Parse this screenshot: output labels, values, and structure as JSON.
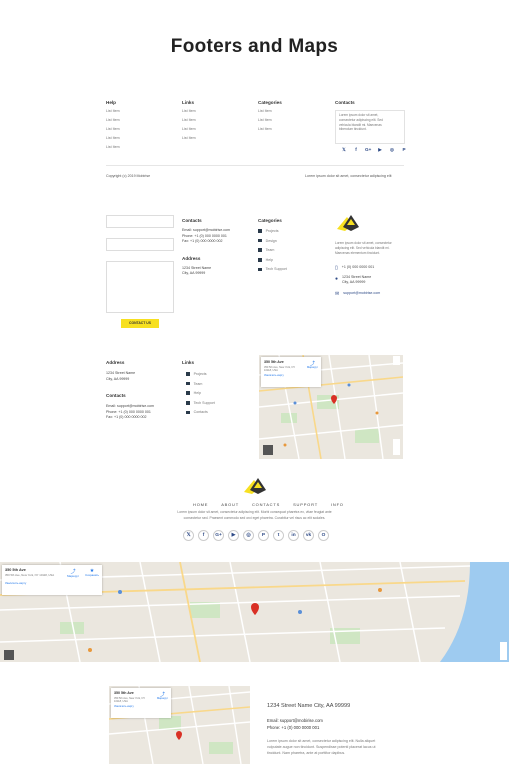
{
  "title": "Footers and Maps",
  "footer1": {
    "columns": [
      {
        "heading": "Help",
        "items": [
          "List Item",
          "List Item",
          "List Item",
          "List Item",
          "List Item"
        ]
      },
      {
        "heading": "Links",
        "items": [
          "List Item",
          "List Item",
          "List Item",
          "List Item"
        ]
      },
      {
        "heading": "Categories",
        "items": [
          "List Item",
          "List Item",
          "List Item"
        ]
      }
    ],
    "contacts_heading": "Contacts",
    "contacts_text": [
      "Lorem ipsum dolor sit amet,",
      "consectetur adipiscing elit. Sed",
      "vehicula blandit mi. Maecenas",
      "bibendum tincidunt."
    ],
    "social_icons": [
      "twitter-icon",
      "facebook-icon",
      "google-plus-icon",
      "youtube-icon",
      "instagram-icon",
      "pinterest-icon"
    ],
    "social_glyphs": [
      "𝕏",
      "f",
      "G+",
      "▶",
      "◎",
      "P"
    ],
    "copyright": "Copyright (c) 2019 Mobirise",
    "tagline": "Lorem ipsum dolor sit amet, consectetur adipiscing elit"
  },
  "footer2": {
    "button_label": "CONTACT US",
    "contacts_heading": "Contacts",
    "contacts_lines": [
      "Email: support@mobirise.com",
      "Phone: +1 (0) 000 0000 001",
      "Fax: +1 (0) 000 0000 002"
    ],
    "address_heading": "Address",
    "address_lines": [
      "1234 Street Name",
      "City, AA 99999"
    ],
    "categories_heading": "Categories",
    "categories": [
      "Projects",
      "Design",
      "Team",
      "Help",
      "Tech Support"
    ],
    "about_text": [
      "Lorem ipsum dolor sit amet, consectetur",
      "adipiscing elit. Sed vehicula blandit mi.",
      "Maecenas elementum tincidunt."
    ],
    "phone": "+1 (0) 000 0000 001",
    "address_line1": "1234 Street Name",
    "address_line2": "City, AA 99999",
    "email": "support@mobirise.com"
  },
  "footer3": {
    "address_heading": "Address",
    "address_lines": [
      "1234 Street Name",
      "City, AA 99999"
    ],
    "contacts_heading": "Contacts",
    "contacts_lines": [
      "Email: support@mobirise.com",
      "Phone: +1 (0) 000 0000 001",
      "Fax: +1 (0) 000 0000 002"
    ],
    "links_heading": "Links",
    "links": [
      "Projects",
      "Team",
      "Help",
      "Tech Support",
      "Contacts"
    ]
  },
  "map_card": {
    "place": "350 5th Ave",
    "address": "350 5th Ave, New York, NY 10118, USA",
    "directions": "Маршрут",
    "save": "Сохранить",
    "larger": "Увеличить карту",
    "pin_label": "350 5th Avenue"
  },
  "footer4": {
    "nav": [
      "HOME",
      "ABOUT",
      "CONTACTS",
      "SUPPORT",
      "INFO"
    ],
    "text_line1": "Lorem ipsum dolor sit amet, consectetur adipiscing elit. Morbi consequat pharetra ex, vitae feugiat ante",
    "text_line2": "consectetur sed. Praesent commodo sed orci eget pharetra. Curabitur vel risus ac elit sodales.",
    "social_glyphs": [
      "𝕏",
      "f",
      "G+",
      "▶",
      "◎",
      "P",
      "t",
      "in",
      "vk",
      "O"
    ],
    "social_icons": [
      "twitter-icon",
      "facebook-icon",
      "google-plus-icon",
      "youtube-icon",
      "instagram-icon",
      "pinterest-icon",
      "tumblr-icon",
      "linkedin-icon",
      "vk-icon",
      "odnoklassniki-icon"
    ]
  },
  "footer5": {
    "address": "1234 Street Name City, AA 99999",
    "email": "Email: support@mobirise.com",
    "phone": "Phone: +1 (0) 000 0000 001",
    "text": [
      "Lorem ipsum dolor sit amet, consectetur adipiscing elit. Nulla aliquet",
      "vulputate augue non tincidunt. Suspendisse potenti placerat lacus ut",
      "tincidunt. Nam pharetra, ante at porttitor dapibus."
    ]
  },
  "colors": {
    "accent": "#f7e021",
    "link": "#2e4a86",
    "pin": "#d93025"
  }
}
